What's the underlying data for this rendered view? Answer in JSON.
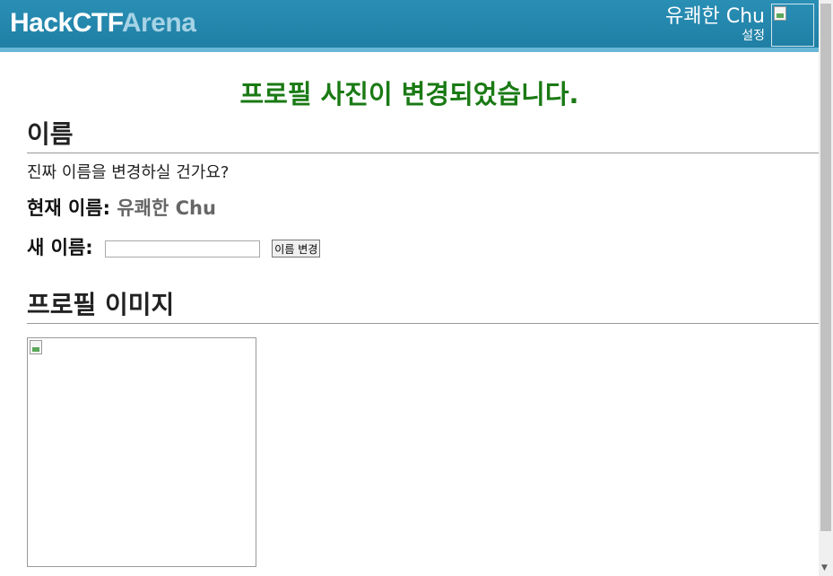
{
  "header": {
    "brand_primary": "HackCTF",
    "brand_secondary": "Arena",
    "username": "유쾌한 Chu",
    "settings_label": "설정",
    "colors": {
      "bar": "#2a8fb5",
      "brand_secondary": "#a6d3e6"
    }
  },
  "main": {
    "success_message": "프로필 사진이 변경되었습니다.",
    "name_section": {
      "heading": "이름",
      "question": "진짜 이름을 변경하실 건가요?",
      "current_label": "현재 이름:",
      "current_value": "유쾌한 Chu",
      "new_label": "새 이름:",
      "new_input_value": "",
      "change_button": "이름 변경"
    },
    "image_section": {
      "heading": "프로필 이미지"
    }
  },
  "colors": {
    "success": "#1a7a14"
  }
}
